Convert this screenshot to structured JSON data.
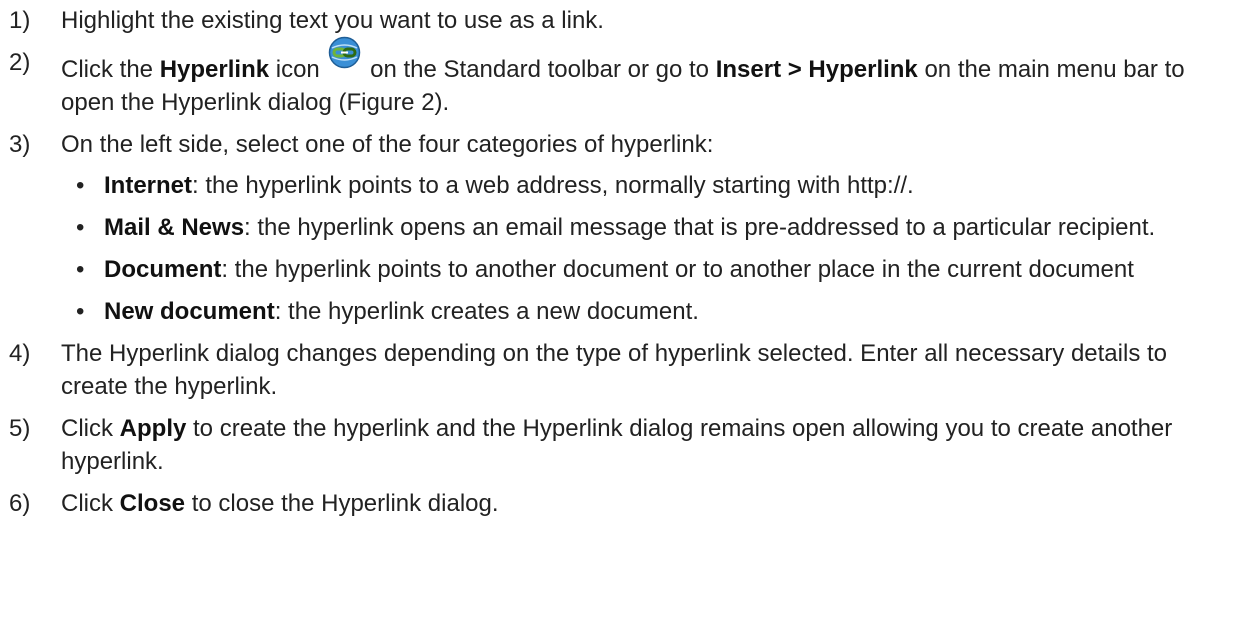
{
  "steps": [
    {
      "num": "1)",
      "parts": [
        {
          "t": "Highlight the existing text you want to use as a link."
        }
      ]
    },
    {
      "num": "2)",
      "parts": [
        {
          "t": "Click the "
        },
        {
          "b": "Hyperlink"
        },
        {
          "t": " icon "
        },
        {
          "icon": "hyperlink-icon"
        },
        {
          "t": " on the Standard toolbar or go to "
        },
        {
          "b": "Insert > Hyperlink"
        },
        {
          "t": " on the main menu bar to open the Hyperlink dialog (Figure 2)."
        }
      ]
    },
    {
      "num": "3)",
      "parts": [
        {
          "t": "On the left side, select one of the four categories of hyperlink:"
        }
      ],
      "bullets": [
        [
          {
            "b": "Internet"
          },
          {
            "t": ": the hyperlink points to a web address, normally starting with http://."
          }
        ],
        [
          {
            "b": "Mail & News"
          },
          {
            "t": ": the hyperlink opens an email message that is pre-addressed to a particular recipient."
          }
        ],
        [
          {
            "b": "Document"
          },
          {
            "t": ": the hyperlink points to another document or to another place in the current document"
          }
        ],
        [
          {
            "b": "New document"
          },
          {
            "t": ": the hyperlink creates a new document."
          }
        ]
      ]
    },
    {
      "num": "4)",
      "parts": [
        {
          "t": "The Hyperlink dialog changes depending on the type of hyperlink selected. Enter all necessary details to create the hyperlink."
        }
      ]
    },
    {
      "num": "5)",
      "parts": [
        {
          "t": "Click "
        },
        {
          "b": "Apply"
        },
        {
          "t": " to create the hyperlink and the Hyperlink dialog remains open allowing you to create another hyperlink."
        }
      ]
    },
    {
      "num": "6)",
      "parts": [
        {
          "t": "Click "
        },
        {
          "b": "Close"
        },
        {
          "t": " to close the Hyperlink dialog."
        }
      ]
    }
  ],
  "bullet_char": "•",
  "colors": {
    "text": "#222222",
    "icon_globe": "#3a8fd6",
    "icon_chain": "#6fb33a"
  }
}
